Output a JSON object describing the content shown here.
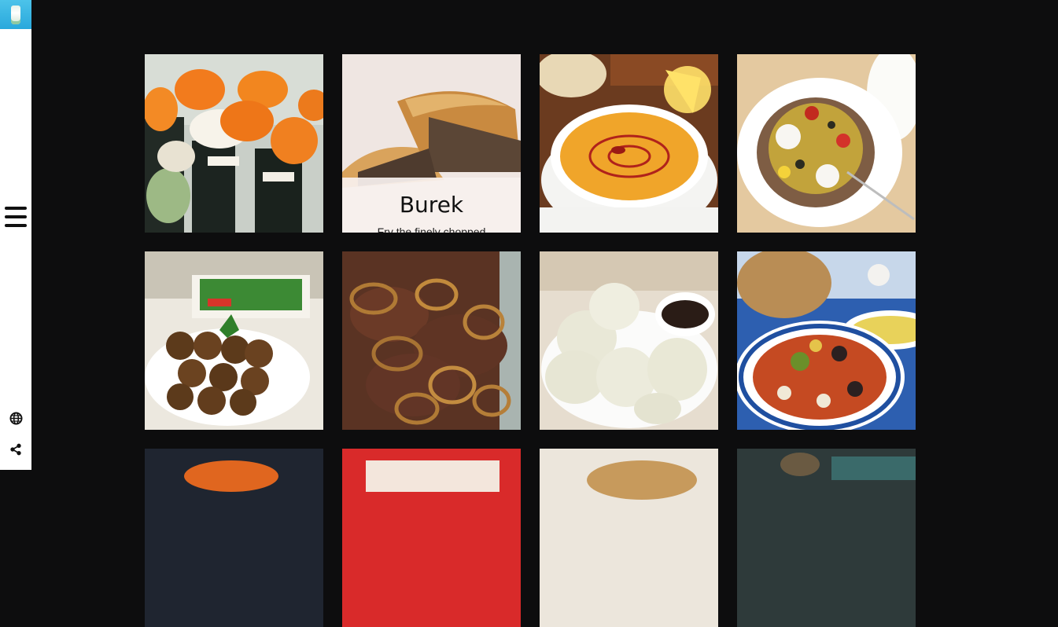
{
  "sidebar": {
    "logo_icon": "milk-bottle-logo-icon",
    "menu_icon": "hamburger-icon",
    "bottom_icons": [
      "globe-icon",
      "share-icon"
    ]
  },
  "dishes": [
    {
      "name": "sushi",
      "image": "sushi-rolls-photo",
      "colors": [
        "#f28a20",
        "#1f2a22"
      ]
    },
    {
      "name": "Burek",
      "image": "burek-pastry-photo",
      "overlay_title": "Burek",
      "overlay_text": "Fry the finely chopped",
      "hovered": true
    },
    {
      "name": "lentil-soup",
      "image": "lentil-soup-photo"
    },
    {
      "name": "stuffed-potato",
      "image": "stuffed-baked-potato-photo"
    },
    {
      "name": "falafel",
      "image": "falafel-photo"
    },
    {
      "name": "liver-onions",
      "image": "liver-and-onions-photo"
    },
    {
      "name": "dumplings",
      "image": "dumplings-photo"
    },
    {
      "name": "salad-platter",
      "image": "mediterranean-salad-photo"
    },
    {
      "name": "row3-1",
      "image": "food-photo"
    },
    {
      "name": "row3-2",
      "image": "food-photo"
    },
    {
      "name": "row3-3",
      "image": "food-photo"
    },
    {
      "name": "row3-4",
      "image": "food-photo"
    }
  ]
}
